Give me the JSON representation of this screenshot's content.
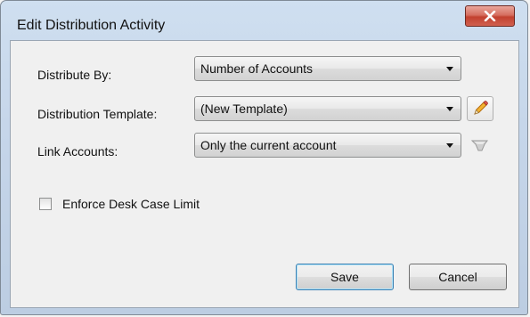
{
  "window": {
    "title": "Edit Distribution Activity"
  },
  "icons": {
    "close": "close-icon",
    "pencil": "pencil-icon",
    "link": "link-icon",
    "dropdown": "chevron-down-icon"
  },
  "form": {
    "distribute_by": {
      "label": "Distribute By:",
      "value": "Number of Accounts"
    },
    "distribution_template": {
      "label": "Distribution Template:",
      "value": "(New Template)"
    },
    "link_accounts": {
      "label": "Link Accounts:",
      "value": "Only the current account"
    },
    "enforce_desk_case_limit": {
      "label": "Enforce Desk Case Limit",
      "checked": false
    }
  },
  "buttons": {
    "save": "Save",
    "cancel": "Cancel"
  },
  "colors": {
    "title_bar": "#c6d6ea",
    "close_button": "#c2412f",
    "default_button_border": "#3c7fb1"
  }
}
